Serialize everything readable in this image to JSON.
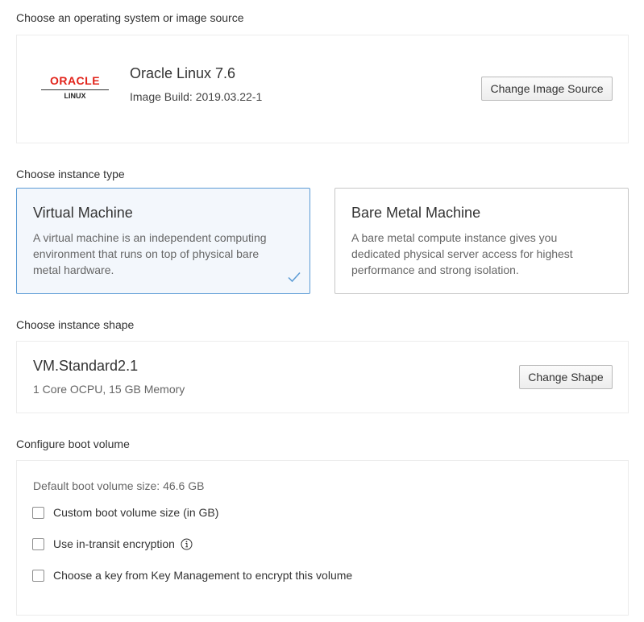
{
  "image_section": {
    "title": "Choose an operating system or image source",
    "logo_brand": "ORACLE",
    "logo_sub": "LINUX",
    "image_name": "Oracle Linux 7.6",
    "image_build": "Image Build: 2019.03.22-1",
    "change_button": "Change Image Source",
    "brand_color": "#e2231a"
  },
  "instance_type": {
    "title": "Choose instance type",
    "options": [
      {
        "title": "Virtual Machine",
        "description": "A virtual machine is an independent computing environment that runs on top of physical bare metal hardware.",
        "selected": true
      },
      {
        "title": "Bare Metal Machine",
        "description": "A bare metal compute instance gives you dedicated physical server access for highest performance and strong isolation.",
        "selected": false
      }
    ],
    "selected_icon": "checkmark-icon",
    "selected_border_color": "#5b9bd5"
  },
  "shape_section": {
    "title": "Choose instance shape",
    "shape_name": "VM.Standard2.1",
    "shape_details": "1 Core OCPU, 15 GB Memory",
    "change_button": "Change Shape"
  },
  "boot_volume": {
    "title": "Configure boot volume",
    "default_size": "Default boot volume size: 46.6 GB",
    "options": [
      {
        "label": "Custom boot volume size (in GB)",
        "checked": false
      },
      {
        "label": "Use in-transit encryption",
        "checked": false,
        "info_icon": "info-icon"
      },
      {
        "label": "Choose a key from Key Management to encrypt this volume",
        "checked": false
      }
    ]
  }
}
